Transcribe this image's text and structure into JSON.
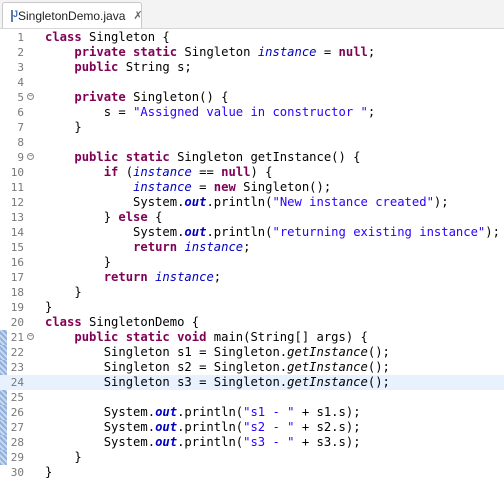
{
  "tab": {
    "title": "SingletonDemo.java",
    "close_glyph": "✗"
  },
  "lines": [
    {
      "num": "1",
      "fold": "",
      "tokens": [
        [
          "kw",
          "class"
        ],
        [
          "plain",
          " Singleton {"
        ]
      ]
    },
    {
      "num": "2",
      "fold": "",
      "tokens": [
        [
          "plain",
          "    "
        ],
        [
          "kw",
          "private static"
        ],
        [
          "plain",
          " Singleton "
        ],
        [
          "fld",
          "instance"
        ],
        [
          "plain",
          " = "
        ],
        [
          "kw",
          "null"
        ],
        [
          "plain",
          ";"
        ]
      ]
    },
    {
      "num": "3",
      "fold": "",
      "tokens": [
        [
          "plain",
          "    "
        ],
        [
          "kw",
          "public"
        ],
        [
          "plain",
          " String s;"
        ]
      ]
    },
    {
      "num": "4",
      "fold": "",
      "tokens": []
    },
    {
      "num": "5",
      "fold": "−",
      "tokens": [
        [
          "plain",
          "    "
        ],
        [
          "kw",
          "private"
        ],
        [
          "plain",
          " Singleton() {"
        ]
      ]
    },
    {
      "num": "6",
      "fold": "",
      "tokens": [
        [
          "plain",
          "        s = "
        ],
        [
          "str",
          "\"Assigned value in constructor \""
        ],
        [
          "plain",
          ";"
        ]
      ]
    },
    {
      "num": "7",
      "fold": "",
      "tokens": [
        [
          "plain",
          "    }"
        ]
      ]
    },
    {
      "num": "8",
      "fold": "",
      "tokens": []
    },
    {
      "num": "9",
      "fold": "−",
      "tokens": [
        [
          "plain",
          "    "
        ],
        [
          "kw",
          "public static"
        ],
        [
          "plain",
          " Singleton getInstance() {"
        ]
      ]
    },
    {
      "num": "10",
      "fold": "",
      "tokens": [
        [
          "plain",
          "        "
        ],
        [
          "kw",
          "if"
        ],
        [
          "plain",
          " ("
        ],
        [
          "fld",
          "instance"
        ],
        [
          "plain",
          " == "
        ],
        [
          "kw",
          "null"
        ],
        [
          "plain",
          ") {"
        ]
      ]
    },
    {
      "num": "11",
      "fold": "",
      "tokens": [
        [
          "plain",
          "            "
        ],
        [
          "fld",
          "instance"
        ],
        [
          "plain",
          " = "
        ],
        [
          "kw",
          "new"
        ],
        [
          "plain",
          " Singleton();"
        ]
      ]
    },
    {
      "num": "12",
      "fold": "",
      "tokens": [
        [
          "plain",
          "            System."
        ],
        [
          "sfld",
          "out"
        ],
        [
          "plain",
          ".println("
        ],
        [
          "str",
          "\"New instance created\""
        ],
        [
          "plain",
          ");"
        ]
      ]
    },
    {
      "num": "13",
      "fold": "",
      "tokens": [
        [
          "plain",
          "        } "
        ],
        [
          "kw",
          "else"
        ],
        [
          "plain",
          " {"
        ]
      ]
    },
    {
      "num": "14",
      "fold": "",
      "tokens": [
        [
          "plain",
          "            System."
        ],
        [
          "sfld",
          "out"
        ],
        [
          "plain",
          ".println("
        ],
        [
          "str",
          "\"returning existing instance\""
        ],
        [
          "plain",
          ");"
        ]
      ]
    },
    {
      "num": "15",
      "fold": "",
      "tokens": [
        [
          "plain",
          "            "
        ],
        [
          "kw",
          "return"
        ],
        [
          "plain",
          " "
        ],
        [
          "fld",
          "instance"
        ],
        [
          "plain",
          ";"
        ]
      ]
    },
    {
      "num": "16",
      "fold": "",
      "tokens": [
        [
          "plain",
          "        }"
        ]
      ]
    },
    {
      "num": "17",
      "fold": "",
      "tokens": [
        [
          "plain",
          "        "
        ],
        [
          "kw",
          "return"
        ],
        [
          "plain",
          " "
        ],
        [
          "fld",
          "instance"
        ],
        [
          "plain",
          ";"
        ]
      ]
    },
    {
      "num": "18",
      "fold": "",
      "tokens": [
        [
          "plain",
          "    }"
        ]
      ]
    },
    {
      "num": "19",
      "fold": "",
      "tokens": [
        [
          "plain",
          "}"
        ]
      ]
    },
    {
      "num": "20",
      "fold": "",
      "tokens": [
        [
          "kw",
          "class"
        ],
        [
          "plain",
          " SingletonDemo {"
        ]
      ]
    },
    {
      "num": "21",
      "fold": "−",
      "tokens": [
        [
          "plain",
          "    "
        ],
        [
          "kw",
          "public static void"
        ],
        [
          "plain",
          " main(String[] args) {"
        ]
      ]
    },
    {
      "num": "22",
      "fold": "",
      "tokens": [
        [
          "plain",
          "        Singleton s1 = Singleton."
        ],
        [
          "sm",
          "getInstance"
        ],
        [
          "plain",
          "();"
        ]
      ]
    },
    {
      "num": "23",
      "fold": "",
      "tokens": [
        [
          "plain",
          "        Singleton s2 = Singleton."
        ],
        [
          "sm",
          "getInstance"
        ],
        [
          "plain",
          "();"
        ]
      ]
    },
    {
      "num": "24",
      "fold": "",
      "tokens": [
        [
          "plain",
          "        Singleton s3 = Singleton."
        ],
        [
          "sm",
          "getInstance"
        ],
        [
          "plain",
          "();"
        ]
      ]
    },
    {
      "num": "25",
      "fold": "",
      "tokens": []
    },
    {
      "num": "26",
      "fold": "",
      "tokens": [
        [
          "plain",
          "        System."
        ],
        [
          "sfld",
          "out"
        ],
        [
          "plain",
          ".println("
        ],
        [
          "str",
          "\"s1 - \""
        ],
        [
          "plain",
          " + s1.s);"
        ]
      ]
    },
    {
      "num": "27",
      "fold": "",
      "tokens": [
        [
          "plain",
          "        System."
        ],
        [
          "sfld",
          "out"
        ],
        [
          "plain",
          ".println("
        ],
        [
          "str",
          "\"s2 - \""
        ],
        [
          "plain",
          " + s2.s);"
        ]
      ]
    },
    {
      "num": "28",
      "fold": "",
      "tokens": [
        [
          "plain",
          "        System."
        ],
        [
          "sfld",
          "out"
        ],
        [
          "plain",
          ".println("
        ],
        [
          "str",
          "\"s3 - \""
        ],
        [
          "plain",
          " + s3.s);"
        ]
      ]
    },
    {
      "num": "29",
      "fold": "",
      "tokens": [
        [
          "plain",
          "    }"
        ]
      ]
    },
    {
      "num": "30",
      "fold": "",
      "tokens": [
        [
          "plain",
          "}"
        ]
      ]
    }
  ],
  "current_line": "24",
  "changed_lines": [
    "21",
    "22",
    "23",
    "24",
    "25",
    "26",
    "27",
    "28",
    "29"
  ],
  "colors": {
    "keyword": "#7f0055",
    "field": "#0000c0",
    "string": "#2a00ff",
    "current_line_bg": "#e8f2fe",
    "line_number": "#787878"
  }
}
